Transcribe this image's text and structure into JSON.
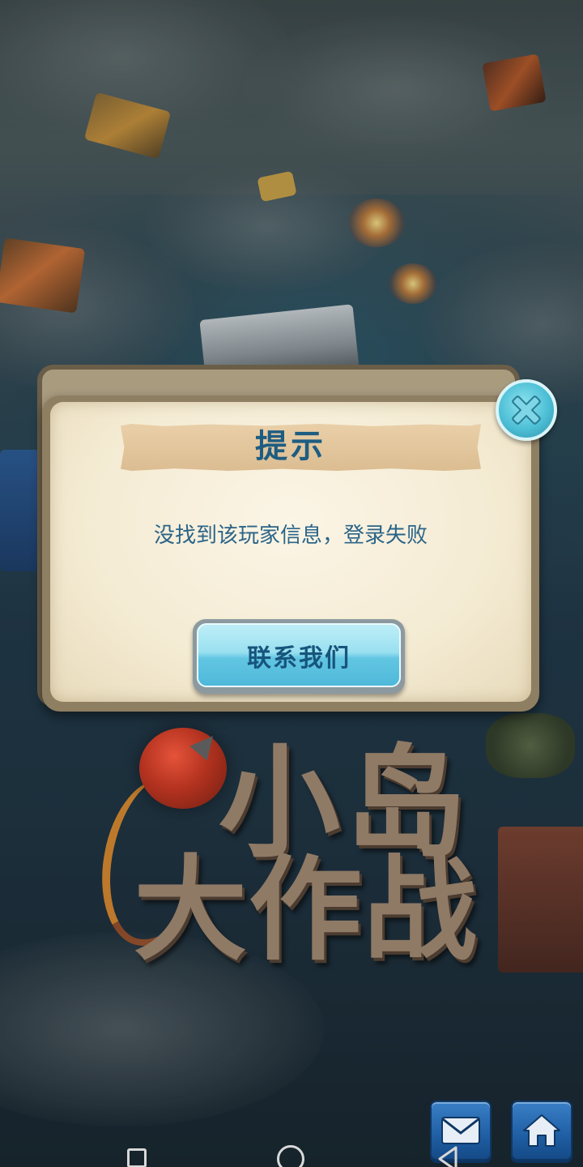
{
  "dialog": {
    "title": "提示",
    "message": "没找到该玩家信息，登录失败",
    "contact_button_label": "联系我们"
  },
  "game_logo": {
    "line1": "小岛",
    "line2": "大作战"
  },
  "icons": {
    "close": "close-icon",
    "mail": "mail-icon",
    "home": "home-icon",
    "nav_recent": "recent-apps-icon",
    "nav_home": "home-circle-icon",
    "nav_back": "back-triangle-icon"
  },
  "colors": {
    "title_text": "#1e5d82",
    "message_text": "#2a6488",
    "button_cyan": "#62c6e2",
    "corner_button_blue": "#1f5ea3"
  }
}
